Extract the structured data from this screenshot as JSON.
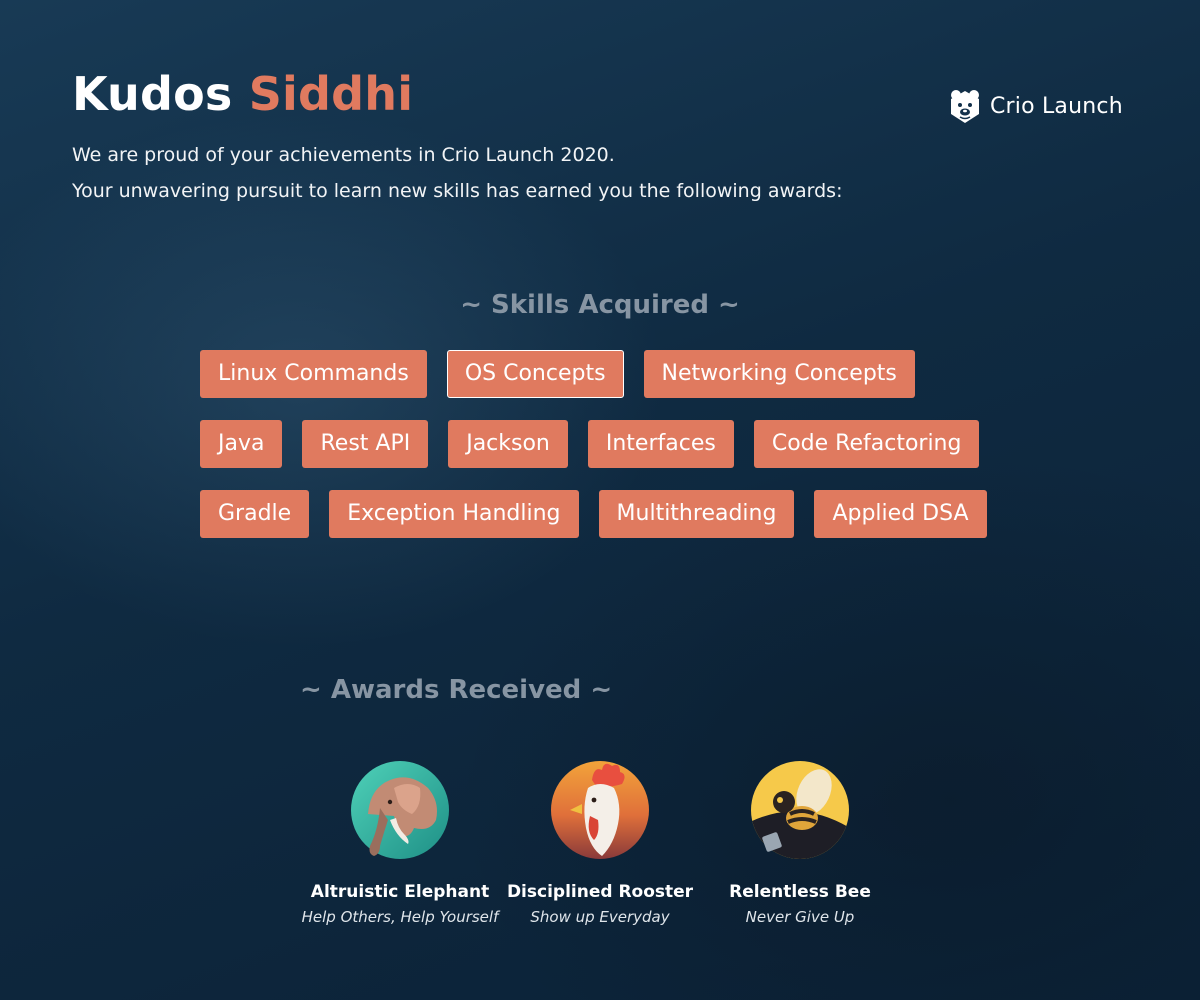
{
  "header": {
    "greeting": "Kudos",
    "name": "Siddhi",
    "brand_icon": "bear-logo-icon",
    "brand_name": "Crio Launch"
  },
  "intro": {
    "line1": "We are proud of your achievements in Crio Launch 2020.",
    "line2": "Your unwavering pursuit to learn new skills has earned you the following awards:"
  },
  "skills": {
    "title": "~ Skills Acquired ~",
    "rows": [
      [
        "Linux Commands",
        "OS Concepts",
        "Networking Concepts"
      ],
      [
        "Java",
        "Rest API",
        "Jackson",
        "Interfaces",
        "Code Refactoring"
      ],
      [
        "Gradle",
        "Exception Handling",
        "Multithreading",
        "Applied DSA"
      ]
    ],
    "active_chip": "OS Concepts"
  },
  "awards": {
    "title": "~ Awards Received ~",
    "items": [
      {
        "name": "Altruistic Elephant",
        "motto": "Help Others, Help Yourself",
        "icon": "elephant-badge-icon"
      },
      {
        "name": "Disciplined Rooster",
        "motto": "Show up Everyday",
        "icon": "rooster-badge-icon"
      },
      {
        "name": "Relentless Bee",
        "motto": "Never Give Up",
        "icon": "bee-badge-icon"
      }
    ]
  },
  "colors": {
    "accent": "#e07a5f",
    "background": "#0f2a41",
    "muted_title": "#8795a3"
  }
}
